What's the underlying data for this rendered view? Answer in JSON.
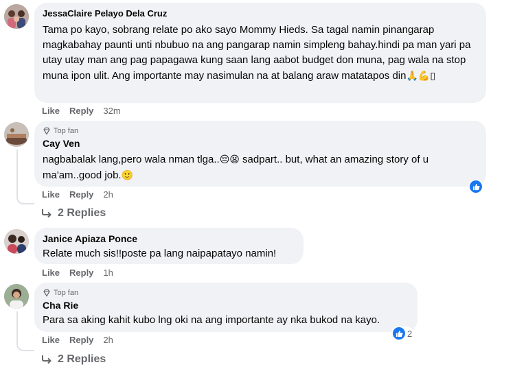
{
  "comments": [
    {
      "author": "JessaClaire Pelayo Dela Cruz",
      "text": "Tama po kayo, sobrang relate po ako sayo Mommy Hieds. Sa tagal namin pinangarap magkabahay paunti unti nbubuo na ang pangarap namin simpleng bahay.hindi pa man yari pa utay utay man ang pag papagawa kung saan lang aabot budget don muna, pag wala na stop muna ipon ulit. Ang importante may nasimulan na at balang araw matatapos din",
      "emojis": "🙏💪▯",
      "like": "Like",
      "reply": "Reply",
      "time": "32m"
    },
    {
      "badge": "Top fan",
      "author": "Cay Ven",
      "text_part1": "nagbabalak lang,pero wala nman tlga..",
      "emojis_1": "😔😫",
      "text_part2": " sadpart.. but, what an amazing story of u ma'am..good job.",
      "emojis_2": "🙂",
      "like": "Like",
      "reply": "Reply",
      "time": "2h",
      "replies": "2 Replies"
    },
    {
      "author": "Janice Apiaza Ponce",
      "text": "Relate much sis!!poste pa lang naipapatayo namin!",
      "like": "Like",
      "reply": "Reply",
      "time": "1h"
    },
    {
      "badge": "Top fan",
      "author": "Cha Rie",
      "text": "Para sa aking kahit kubo lng oki na ang importante ay nka bukod na kayo.",
      "like": "Like",
      "reply": "Reply",
      "time": "2h",
      "reaction_count": "2",
      "replies": "2 Replies"
    }
  ],
  "colors": {
    "bubble": "#f0f2f5",
    "meta": "#65676b",
    "like_blue": "#1877f2"
  }
}
